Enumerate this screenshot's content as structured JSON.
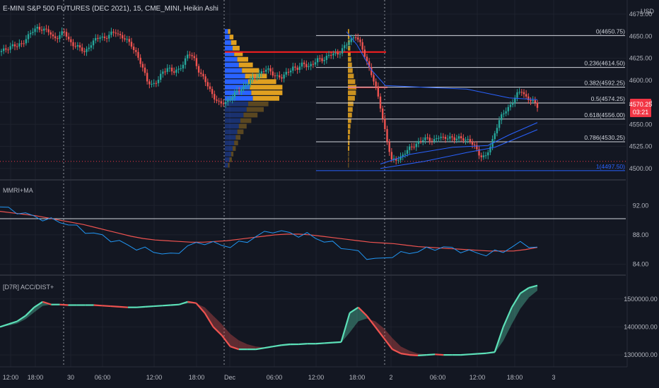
{
  "header": {
    "title": "E-MINI S&P 500 FUTURES (DEC 2021), 15, CME_MINI, Heikin Ashi",
    "currency": "USD"
  },
  "colors": {
    "background": "#131722",
    "up_candle": "#26a69a",
    "down_candle": "#ef5350",
    "osc_line": "#2196f3",
    "osc_ma": "#ef5350",
    "vp_up": "#2962ff",
    "vp_down": "#e0a020",
    "price_tag": "#f23645",
    "accdist_up": "#5ce0b8",
    "accdist_down": "#ef5350"
  },
  "chart_data": [
    {
      "type": "candlestick",
      "pane": "price",
      "ylim": [
        4495,
        4675
      ],
      "y_ticks": [
        "4675.00",
        "4650.00",
        "4625.00",
        "4600.00",
        "4575.00",
        "4550.00",
        "4525.00",
        "4500.00"
      ],
      "x_ticks": [
        "12:00",
        "18:00",
        "30",
        "06:00",
        "12:00",
        "18:00",
        "Dec",
        "06:00",
        "12:00",
        "18:00",
        "2",
        "06:00",
        "12:00",
        "18:00",
        "3"
      ],
      "last_price": "4570.25",
      "countdown": "03:21",
      "close_path": [
        4632,
        4636,
        4640,
        4638,
        4642,
        4650,
        4655,
        4660,
        4658,
        4655,
        4648,
        4650,
        4655,
        4645,
        4640,
        4636,
        4632,
        4640,
        4645,
        4650,
        4648,
        4652,
        4655,
        4650,
        4645,
        4640,
        4630,
        4615,
        4600,
        4595,
        4598,
        4610,
        4615,
        4608,
        4612,
        4620,
        4630,
        4625,
        4610,
        4600,
        4590,
        4580,
        4572,
        4575,
        4580,
        4585,
        4590,
        4595,
        4600,
        4605,
        4610,
        4612,
        4608,
        4605,
        4602,
        4610,
        4615,
        4612,
        4620,
        4616,
        4618,
        4625,
        4624,
        4628,
        4630,
        4632,
        4638,
        4645,
        4652,
        4640,
        4625,
        4610,
        4590,
        4565,
        4535,
        4508,
        4510,
        4515,
        4520,
        4525,
        4530,
        4532,
        4534,
        4532,
        4535,
        4534,
        4537,
        4532,
        4535,
        4534,
        4530,
        4525,
        4515,
        4512,
        4525,
        4545,
        4558,
        4566,
        4574,
        4583,
        4588,
        4580,
        4576,
        4570
      ],
      "fibonacci": [
        {
          "label": "0(4650.75)",
          "value": 4650.75
        },
        {
          "label": "0.236(4614.50)",
          "value": 4614.5
        },
        {
          "label": "0.382(4592.25)",
          "value": 4592.25
        },
        {
          "label": "0.5(4574.25)",
          "value": 4574.25
        },
        {
          "label": "0.618(4556.00)",
          "value": 4556.0
        },
        {
          "label": "0.786(4530.25)",
          "value": 4530.25
        },
        {
          "label": "1(4497.50)",
          "value": 4497.5
        }
      ],
      "volume_profile": {
        "poc": 4632,
        "rows_up": [
          0.4,
          0.6,
          0.8,
          1.0,
          1.2,
          1.6,
          1.8,
          2.2,
          2.6,
          3.0,
          3.2,
          3.4,
          3.6,
          3.0,
          2.8,
          2.4,
          2.0,
          1.8,
          1.6,
          1.4,
          1.2,
          1.0,
          0.8,
          0.6,
          0.4
        ],
        "rows_down": [
          0.3,
          0.5,
          0.7,
          0.9,
          1.1,
          1.4,
          1.8,
          2.2,
          2.8,
          3.6,
          4.2,
          4.0,
          3.4,
          2.6,
          2.2,
          1.8,
          1.4,
          1.0,
          0.8,
          0.6,
          0.5,
          0.4,
          0.3,
          0.3,
          0.2
        ]
      }
    },
    {
      "type": "line",
      "pane": "oscillator",
      "title": "MMRI+MA",
      "ylim": [
        83,
        95
      ],
      "y_ticks": [
        "92.00",
        "88.00",
        "84.00"
      ],
      "reference_level": 90.2,
      "series": [
        {
          "role": "line",
          "values": [
            91.8,
            91.5,
            91.2,
            90.8,
            90.5,
            90.2,
            90.0,
            89.8,
            89.5,
            89.0,
            88.5,
            88.2,
            87.8,
            87.4,
            87.0,
            86.6,
            86.2,
            86.0,
            85.8,
            85.5,
            85.2,
            85.8,
            86.4,
            86.8,
            87.0,
            86.8,
            86.6,
            86.5,
            86.8,
            87.2,
            87.8,
            88.2,
            88.6,
            88.4,
            88.2,
            88.0,
            88.0,
            87.6,
            87.2,
            86.8,
            86.4,
            86.0,
            85.6,
            85.0,
            84.6,
            84.8,
            85.2,
            85.4,
            85.6,
            85.8,
            86.0,
            86.2,
            86.3,
            86.1,
            85.9,
            85.7,
            85.5,
            85.4,
            85.6,
            85.8,
            86.4,
            86.8,
            86.6,
            86.2
          ]
        },
        {
          "role": "ma",
          "values": [
            91.2,
            91.0,
            90.8,
            90.6,
            90.3,
            90.0,
            89.7,
            89.4,
            89.0,
            88.6,
            88.2,
            87.8,
            87.5,
            87.3,
            87.2,
            87.1,
            87.0,
            87.0,
            87.1,
            87.2,
            87.4,
            87.6,
            87.8,
            88.0,
            88.1,
            88.1,
            88.0,
            87.8,
            87.6,
            87.4,
            87.2,
            87.0,
            86.9,
            86.8,
            86.6,
            86.4,
            86.3,
            86.2,
            86.1,
            86.0,
            85.9,
            85.8,
            85.8,
            85.8,
            86.0,
            86.3
          ]
        }
      ]
    },
    {
      "type": "area",
      "pane": "indicator",
      "title": "[D7R] ACC/DIST+",
      "ylim": [
        1270000,
        1570000
      ],
      "y_ticks": [
        "1500000.00",
        "1400000.00",
        "1300000.00"
      ],
      "series": [
        {
          "role": "line",
          "values": [
            1400000,
            1410000,
            1420000,
            1440000,
            1470000,
            1490000,
            1480000,
            1480000,
            1478000,
            1478000,
            1478000,
            1478000,
            1476000,
            1474000,
            1472000,
            1470000,
            1470000,
            1472000,
            1474000,
            1476000,
            1478000,
            1480000,
            1490000,
            1485000,
            1450000,
            1400000,
            1370000,
            1330000,
            1320000,
            1320000,
            1320000,
            1325000,
            1330000,
            1335000,
            1338000,
            1338000,
            1340000,
            1340000,
            1342000,
            1344000,
            1346000,
            1450000,
            1470000,
            1440000,
            1400000,
            1360000,
            1320000,
            1305000,
            1300000,
            1298000,
            1300000,
            1302000,
            1300000,
            1300000,
            1300000,
            1302000,
            1304000,
            1306000,
            1310000,
            1400000,
            1470000,
            1520000,
            1540000,
            1548000
          ]
        },
        {
          "role": "signal",
          "values": [
            1400000,
            1405000,
            1412000,
            1428000,
            1452000,
            1475000,
            1480000,
            1480000,
            1478000,
            1478000,
            1478000,
            1478000,
            1476000,
            1474000,
            1472000,
            1470000,
            1470000,
            1471000,
            1473000,
            1475000,
            1477000,
            1479000,
            1484000,
            1484000,
            1470000,
            1440000,
            1410000,
            1375000,
            1352000,
            1338000,
            1330000,
            1327000,
            1328000,
            1331000,
            1334000,
            1336000,
            1338000,
            1339000,
            1340000,
            1342000,
            1344000,
            1380000,
            1420000,
            1430000,
            1420000,
            1395000,
            1360000,
            1330000,
            1315000,
            1305000,
            1302000,
            1301000,
            1300000,
            1300000,
            1300000,
            1301000,
            1302000,
            1304000,
            1307000,
            1350000,
            1410000,
            1465000,
            1505000,
            1530000
          ]
        }
      ]
    }
  ]
}
